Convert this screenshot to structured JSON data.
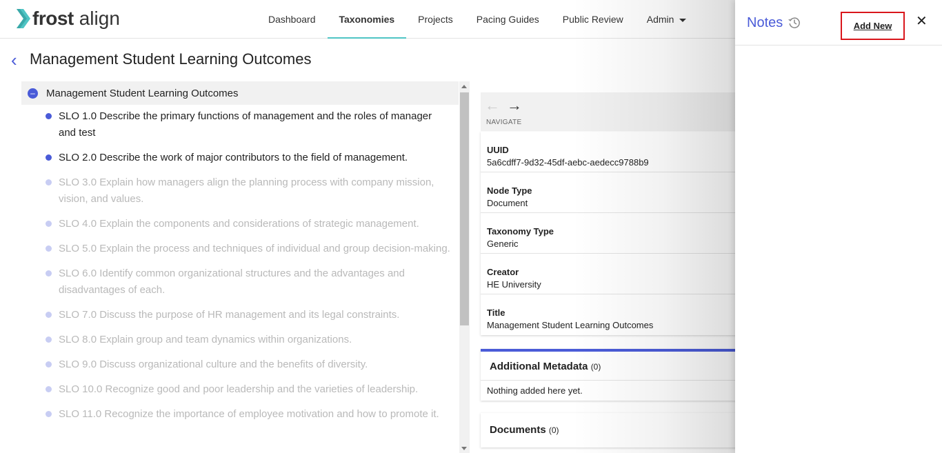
{
  "brand": {
    "name_bold": "frost",
    "name_light": "align",
    "accent": "#4fc4c4",
    "primary": "#4a5bd8"
  },
  "nav": {
    "items": [
      {
        "label": "Dashboard"
      },
      {
        "label": "Taxonomies",
        "active": true
      },
      {
        "label": "Projects"
      },
      {
        "label": "Pacing Guides"
      },
      {
        "label": "Public Review"
      },
      {
        "label": "Admin",
        "has_dropdown": true
      }
    ]
  },
  "page": {
    "title": "Management Student Learning Outcomes"
  },
  "tree": {
    "root": "Management Student Learning Outcomes",
    "items": [
      {
        "text": "SLO 1.0 Describe the primary functions of management and the roles of manager and test",
        "dimmed": false
      },
      {
        "text": "SLO 2.0 Describe the work of major contributors to the field of management.",
        "dimmed": false
      },
      {
        "text": "SLO 3.0 Explain how managers align the planning process with company mission, vision, and values.",
        "dimmed": true
      },
      {
        "text": "SLO 4.0 Explain the components and considerations of strategic management.",
        "dimmed": true
      },
      {
        "text": "SLO 5.0 Explain the process and techniques of individual and group decision-making.",
        "dimmed": true
      },
      {
        "text": "SLO 6.0 Identify common organizational structures and the advantages and disadvantages of each.",
        "dimmed": true
      },
      {
        "text": "SLO 7.0 Discuss the purpose of HR management and its legal constraints.",
        "dimmed": true
      },
      {
        "text": "SLO 8.0 Explain group and team dynamics within organizations.",
        "dimmed": true
      },
      {
        "text": "SLO 9.0 Discuss organizational culture and the benefits of diversity.",
        "dimmed": true
      },
      {
        "text": "SLO 10.0 Recognize good and poor leadership and the varieties of leadership.",
        "dimmed": true
      },
      {
        "text": "SLO 11.0 Recognize the importance of employee motivation and how to promote it.",
        "dimmed": true
      }
    ]
  },
  "detail": {
    "navigate_label": "NAVIGATE",
    "properties": [
      {
        "label": "UUID",
        "value": "5a6cdff7-9d32-45df-aebc-aedecc9788b9"
      },
      {
        "label": "Node Type",
        "value": "Document"
      },
      {
        "label": "Taxonomy Type",
        "value": "Generic"
      },
      {
        "label": "Creator",
        "value": "HE University"
      },
      {
        "label": "Title",
        "value": "Management Student Learning Outcomes"
      }
    ],
    "additional_metadata": {
      "title": "Additional Metadata",
      "count": "(0)",
      "empty_text": "Nothing added here yet."
    },
    "documents": {
      "title": "Documents",
      "count": "(0)"
    }
  },
  "notes_drawer": {
    "title": "Notes",
    "add_new_label": "Add New",
    "highlight_color": "#d9151b"
  }
}
